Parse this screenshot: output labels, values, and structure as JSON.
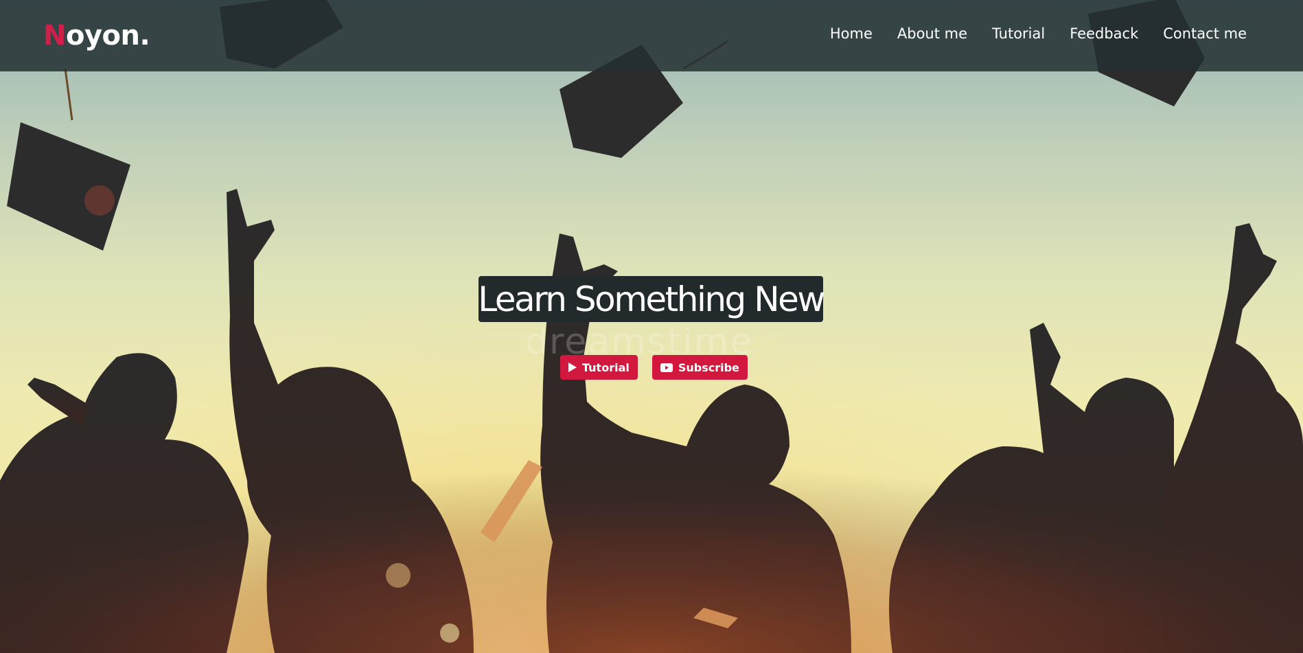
{
  "logo": {
    "initial": "N",
    "rest": "oyon."
  },
  "nav": {
    "items": [
      {
        "label": "Home"
      },
      {
        "label": "About me"
      },
      {
        "label": "Tutorial"
      },
      {
        "label": "Feedback"
      },
      {
        "label": "Contact me"
      }
    ]
  },
  "hero": {
    "headline": "Learn Something New",
    "watermark": "dreamstime",
    "buttons": [
      {
        "label": "Tutorial",
        "icon": "play-icon"
      },
      {
        "label": "Subscribe",
        "icon": "youtube-icon"
      }
    ]
  },
  "colors": {
    "accent": "#d2183f",
    "logo_accent": "#d0204a",
    "navbar_bg": "#243032",
    "headline_bg": "#222a2b"
  }
}
